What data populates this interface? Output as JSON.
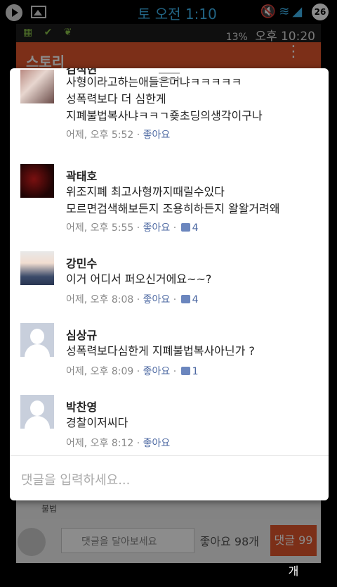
{
  "outer_status": {
    "time": "토 오전 1:10",
    "badge": "26",
    "icons": [
      "play-icon",
      "gallery-icon",
      "mute-icon",
      "wifi-icon",
      "signal-icon"
    ]
  },
  "inner_status": {
    "battery": "13%",
    "clock": "오후 10:20"
  },
  "app_bar": {
    "title": "스토리",
    "menu_glyph": "⋮"
  },
  "background_post": {
    "tiny_text": "불법"
  },
  "bottom_bar": {
    "comment_placeholder": "댓글을 달아보세요",
    "like_count": "좋아요 98개",
    "comment_button": "댓글 99개"
  },
  "comments": [
    {
      "name": "김석현",
      "text": "사형이라고하는애들은머냐ㅋㅋㅋㅋㅋ\n성폭력보다 더 심한게\n지폐불법복사냐ㅋㅋㄱ죶초딩의생각이구나",
      "time": "어제, 오후 5:52",
      "like_label": "좋아요",
      "likes": ""
    },
    {
      "name": "곽태호",
      "text": "위조지폐 최고사형까지때릴수있다\n모르면검색해보든지 조용히하든지 왈왈거려왜",
      "time": "어제, 오후 5:55",
      "like_label": "좋아요",
      "likes": "4"
    },
    {
      "name": "강민수",
      "text": "이거 어디서 퍼오신거에요~~?",
      "time": "어제, 오후 8:08",
      "like_label": "좋아요",
      "likes": "4"
    },
    {
      "name": "심상규",
      "text": "성폭력보다심한게 지폐불법복사아닌가 ?",
      "time": "어제, 오후 8:09",
      "like_label": "좋아요",
      "likes": "1"
    },
    {
      "name": "박찬영",
      "text": "경찰이저씨다",
      "time": "어제, 오후 8:12",
      "like_label": "좋아요",
      "likes": ""
    }
  ],
  "input": {
    "placeholder": "댓글을 입력하세요..."
  }
}
